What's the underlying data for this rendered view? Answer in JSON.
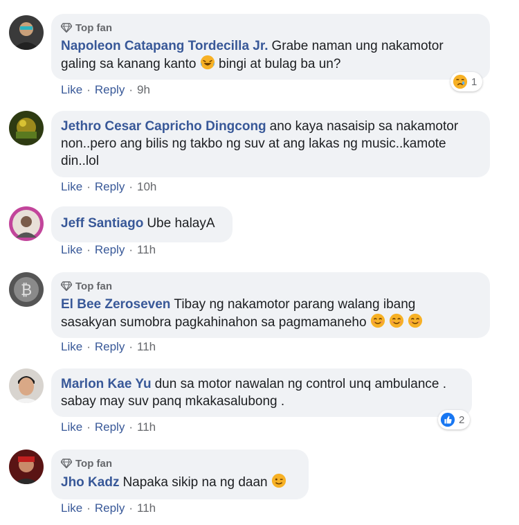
{
  "comments": [
    {
      "badge": "Top fan",
      "author": "Napoleon Catapang Tordecilla Jr.",
      "text_line1": "Grabe naman ung nakamotor",
      "text_line2": "galing sa kanang kanto",
      "text_line2b": "bingi at bulag ba un?",
      "like": "Like",
      "reply": "Reply",
      "time": "9h",
      "reaction_count": "1"
    },
    {
      "author": "Jethro Cesar Capricho Dingcong",
      "text_line1": "ano kaya nasaisip sa nakamotor",
      "text_line2": "non..pero ang bilis ng takbo ng suv at ang lakas ng music..kamote",
      "text_line3": "din..lol",
      "like": "Like",
      "reply": "Reply",
      "time": "10h"
    },
    {
      "author": "Jeff Santiago",
      "text_line1": "Ube halayA",
      "like": "Like",
      "reply": "Reply",
      "time": "11h"
    },
    {
      "badge": "Top fan",
      "author": "El Bee Zeroseven",
      "text_line1": "Tibay ng nakamotor parang walang ibang",
      "text_line2": "sasakyan sumobra pagkahinahon sa pagmamaneho",
      "like": "Like",
      "reply": "Reply",
      "time": "11h"
    },
    {
      "author": "Marlon Kae Yu",
      "text_line1": "dun sa motor nawalan ng control unq ambulance .",
      "text_line2": "sabay may suv panq mkakasalubong .",
      "like": "Like",
      "reply": "Reply",
      "time": "11h",
      "reaction_count": "2"
    },
    {
      "badge": "Top fan",
      "author": "Jho Kadz",
      "text_line1": "Napaka sikip na ng daan",
      "like": "Like",
      "reply": "Reply",
      "time": "11h"
    }
  ],
  "separator": "·"
}
